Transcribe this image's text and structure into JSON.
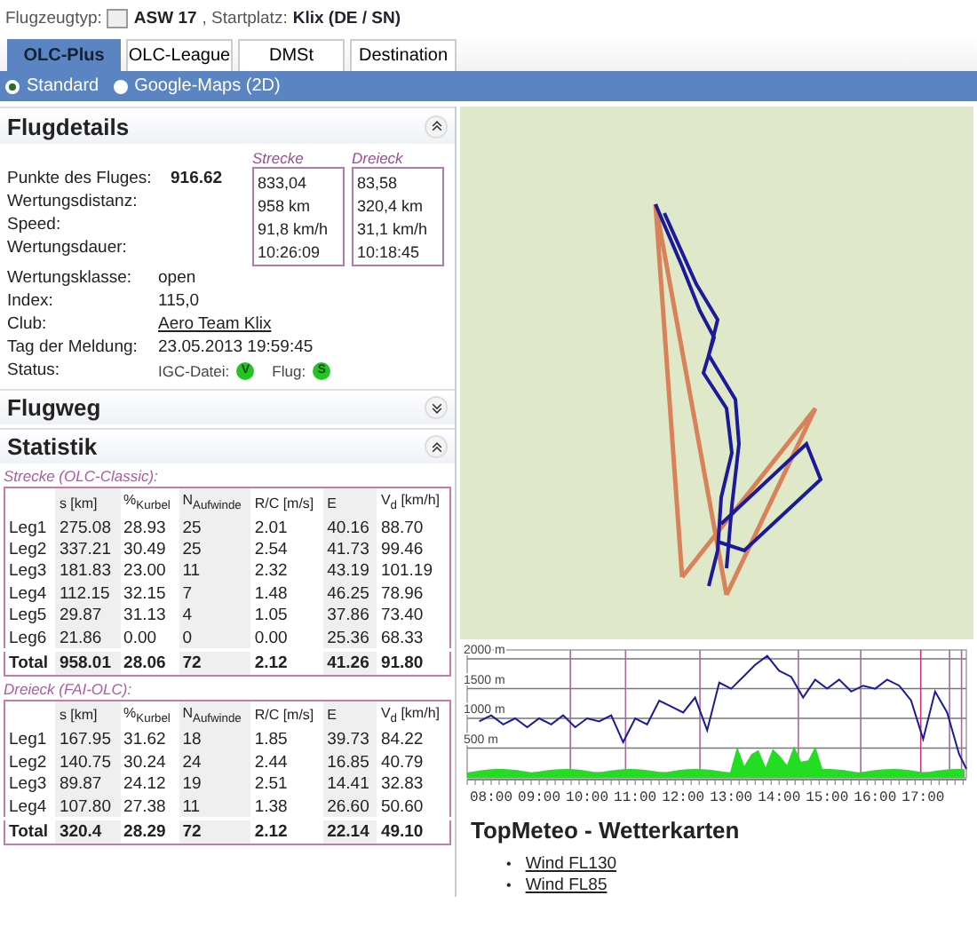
{
  "header": {
    "type_label": "Flugzeugtyp:",
    "aircraft": "ASW 17",
    "site_label": ", Startplatz:",
    "site": "Klix (DE / SN)"
  },
  "tabs": [
    {
      "label": "OLC-Plus",
      "selected": true
    },
    {
      "label": "OLC-League",
      "selected": false
    },
    {
      "label": "DMSt",
      "selected": false
    },
    {
      "label": "Destination",
      "selected": false
    }
  ],
  "map_modes": [
    {
      "label": "Standard",
      "selected": true
    },
    {
      "label": "Google-Maps (2D)",
      "selected": false
    }
  ],
  "flugdetails": {
    "title": "Flugdetails",
    "expanded": true,
    "columns": [
      "Strecke",
      "Dreieck"
    ],
    "score_rows": [
      {
        "label": "Punkte des Fluges:",
        "total": "916.62",
        "values": [
          "833,04",
          "83,58"
        ]
      },
      {
        "label": "Wertungsdistanz:",
        "values": [
          "958 km",
          "320,4 km"
        ]
      },
      {
        "label": "Speed:",
        "values": [
          "91,8 km/h",
          "31,1 km/h"
        ]
      },
      {
        "label": "Wertungsdauer:",
        "values": [
          "10:26:09",
          "10:18:45"
        ]
      }
    ],
    "info_rows": [
      {
        "label": "Wertungsklasse:",
        "value": "open",
        "kind": "text"
      },
      {
        "label": "Index:",
        "value": "115,0",
        "kind": "text"
      },
      {
        "label": "Club:",
        "value": "Aero Team Klix",
        "kind": "link"
      },
      {
        "label": "Tag der Meldung:",
        "value": "23.05.2013 19:59:45",
        "kind": "text"
      }
    ],
    "status": {
      "label": "Status:",
      "items": [
        {
          "label": "IGC-Datei:",
          "badge": "V"
        },
        {
          "label": "Flug:",
          "badge": "S"
        }
      ]
    }
  },
  "flugweg": {
    "title": "Flugweg",
    "expanded": false
  },
  "statistik": {
    "title": "Statistik",
    "expanded": true,
    "tables": [
      {
        "caption": "Strecke (OLC-Classic):",
        "columns": [
          "s [km]",
          "%$_{Kurbel}$",
          "N$_{Aufwinde}$",
          "R/C [m/s]",
          "E",
          "V$_{d}$ [km/h]"
        ],
        "rows": [
          {
            "kind": "leg",
            "label": "Leg1",
            "cells": [
              "275.08",
              "28.93",
              "25",
              "2.01",
              "40.16",
              "88.70"
            ]
          },
          {
            "kind": "leg",
            "label": "Leg2",
            "cells": [
              "337.21",
              "30.49",
              "25",
              "2.54",
              "41.73",
              "99.46"
            ]
          },
          {
            "kind": "leg",
            "label": "Leg3",
            "cells": [
              "181.83",
              "23.00",
              "11",
              "2.32",
              "43.19",
              "101.19"
            ]
          },
          {
            "kind": "leg",
            "label": "Leg4",
            "cells": [
              "112.15",
              "32.15",
              "7",
              "1.48",
              "46.25",
              "78.96"
            ]
          },
          {
            "kind": "leg",
            "label": "Leg5",
            "cells": [
              "29.87",
              "31.13",
              "4",
              "1.05",
              "37.86",
              "73.40"
            ]
          },
          {
            "kind": "leg",
            "label": "Leg6",
            "cells": [
              "21.86",
              "0.00",
              "0",
              "0.00",
              "25.36",
              "68.33"
            ]
          },
          {
            "kind": "total",
            "label": "Total",
            "cells": [
              "958.01",
              "28.06",
              "72",
              "2.12",
              "41.26",
              "91.80"
            ]
          }
        ]
      },
      {
        "caption": "Dreieck (FAI-OLC):",
        "columns": [
          "s [km]",
          "%$_{Kurbel}$",
          "N$_{Aufwinde}$",
          "R/C [m/s]",
          "E",
          "V$_{d}$ [km/h]"
        ],
        "rows": [
          {
            "kind": "leg",
            "label": "Leg1",
            "cells": [
              "167.95",
              "31.62",
              "18",
              "1.85",
              "39.73",
              "84.22"
            ]
          },
          {
            "kind": "leg",
            "label": "Leg2",
            "cells": [
              "140.75",
              "30.24",
              "24",
              "2.44",
              "16.85",
              "40.79"
            ]
          },
          {
            "kind": "leg",
            "label": "Leg3",
            "cells": [
              "89.87",
              "24.12",
              "19",
              "2.51",
              "14.41",
              "32.83"
            ]
          },
          {
            "kind": "leg",
            "label": "Leg4",
            "cells": [
              "107.80",
              "27.38",
              "11",
              "1.38",
              "26.60",
              "50.60"
            ]
          },
          {
            "kind": "total",
            "label": "Total",
            "cells": [
              "320.4",
              "28.29",
              "72",
              "2.12",
              "22.14",
              "49.10"
            ]
          }
        ]
      }
    ]
  },
  "barogram": {
    "chart_data": {
      "type": "line",
      "ylim": [
        0,
        2150
      ],
      "xlim": [
        7.5,
        17.9
      ],
      "grid": true,
      "ref_lines": [
        {
          "axis": "x",
          "value": 9.65,
          "color": "#a76a9a"
        },
        {
          "axis": "x",
          "value": 10.8,
          "color": "#a76a9a"
        },
        {
          "axis": "x",
          "value": 12.35,
          "color": "#a76a9a"
        },
        {
          "axis": "x",
          "value": 14.4,
          "color": "#a76a9a"
        },
        {
          "axis": "x",
          "value": 15.7,
          "color": "#a76a9a"
        },
        {
          "axis": "x",
          "value": 16.95,
          "color": "#d03070"
        },
        {
          "axis": "x",
          "value": 17.55,
          "color": "#a76a9a"
        },
        {
          "axis": "x",
          "value": 17.8,
          "color": "#a76a9a"
        }
      ],
      "yticks": [
        {
          "value": 2000,
          "label": "2000 m"
        },
        {
          "value": 1500,
          "label": "1500 m"
        },
        {
          "value": 1000,
          "label": "1000 m"
        },
        {
          "value": 500,
          "label": "500 m"
        }
      ],
      "xticks": [
        {
          "value": 8,
          "label": "08:00"
        },
        {
          "value": 9,
          "label": "09:00"
        },
        {
          "value": 10,
          "label": "10:00"
        },
        {
          "value": 11,
          "label": "11:00"
        },
        {
          "value": 12,
          "label": "12:00"
        },
        {
          "value": 13,
          "label": "13:00"
        },
        {
          "value": 14,
          "label": "14:00"
        },
        {
          "value": 15,
          "label": "15:00"
        },
        {
          "value": 16,
          "label": "16:00"
        },
        {
          "value": 17,
          "label": "17:00"
        }
      ],
      "x": [
        7.75,
        8,
        8.25,
        8.5,
        8.75,
        9,
        9.25,
        9.5,
        9.75,
        10,
        10.25,
        10.5,
        10.75,
        11,
        11.25,
        11.5,
        11.75,
        12,
        12.25,
        12.5,
        12.75,
        13,
        13.25,
        13.5,
        13.75,
        14,
        14.25,
        14.5,
        14.75,
        15,
        15.25,
        15.5,
        15.75,
        16,
        16.25,
        16.5,
        16.75,
        17,
        17.25,
        17.5,
        17.75,
        17.9
      ],
      "series": [
        {
          "color": "#1a1a9a",
          "values": [
            950,
            1050,
            900,
            1000,
            850,
            1000,
            900,
            1050,
            850,
            1000,
            950,
            1050,
            600,
            1000,
            900,
            1300,
            1200,
            1100,
            1350,
            800,
            1600,
            1500,
            1700,
            1900,
            2050,
            1800,
            1700,
            1350,
            1650,
            1500,
            1650,
            1450,
            1550,
            1500,
            1650,
            1550,
            1300,
            650,
            1450,
            1100,
            400,
            150
          ]
        }
      ]
    }
  },
  "topmeteo": {
    "title": "TopMeteo - Wetterkarten",
    "links": [
      {
        "bullet": "•",
        "label": "Wind FL130"
      },
      {
        "bullet": "•",
        "label": "Wind FL85"
      }
    ]
  }
}
